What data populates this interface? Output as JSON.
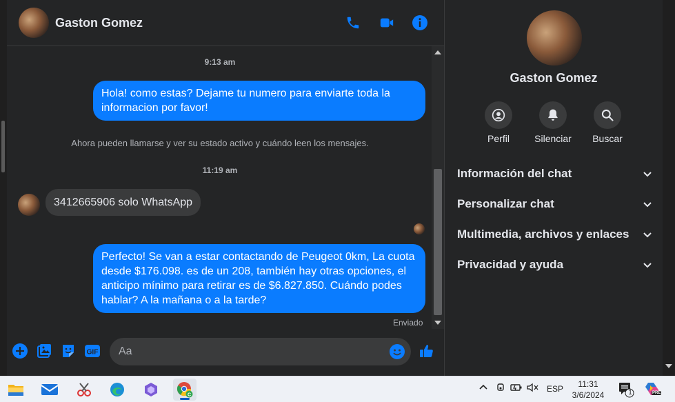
{
  "header": {
    "contact_name": "Gaston Gomez"
  },
  "messages": {
    "timestamp_1": "9:13 am",
    "outgoing_1": "Hola! como estas? Dejame tu numero para enviarte toda la informacion por favor!",
    "notice": "Ahora pueden llamarse y ver su estado activo y cuándo leen los mensajes.",
    "timestamp_2": "11:19 am",
    "incoming_1": "3412665906 solo WhatsApp",
    "outgoing_2": "Perfecto!  Se van a estar contactando de Peugeot 0km, La cuota desde $176.098. es de un 208, también hay otras opciones, el anticipo mínimo para retirar es de $6.827.850. Cuándo podes hablar? A la mañana o a la tarde?",
    "status": "Enviado"
  },
  "composer": {
    "placeholder": "Aa"
  },
  "sidebar": {
    "contact_name": "Gaston Gomez",
    "actions": [
      {
        "label": "Perfil"
      },
      {
        "label": "Silenciar"
      },
      {
        "label": "Buscar"
      }
    ],
    "sections": [
      {
        "label": "Información del chat"
      },
      {
        "label": "Personalizar chat"
      },
      {
        "label": "Multimedia, archivos y enlaces"
      },
      {
        "label": "Privacidad y ayuda"
      }
    ]
  },
  "taskbar": {
    "language": "ESP",
    "time": "11:31",
    "date": "3/6/2024",
    "notification_count": "1",
    "copilot_badge": "PRE"
  },
  "colors": {
    "accent": "#0a7cff",
    "background": "#242526",
    "bubble_in": "#3a3b3c"
  }
}
